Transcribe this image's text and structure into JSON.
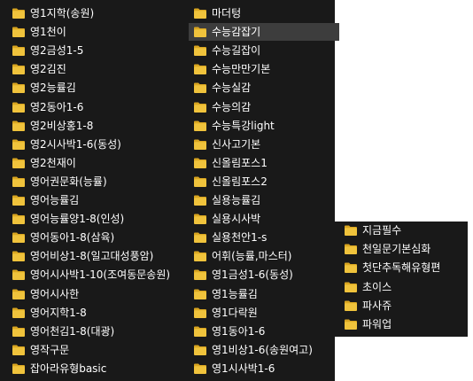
{
  "colors": {
    "background": "#191919",
    "selected": "#3d3d3d",
    "text": "#ffffff",
    "folder": "#f0c33c",
    "folder_dark": "#d9a520"
  },
  "left_column": [
    {
      "label": "영1지학(송원)",
      "icon": "folder-icon"
    },
    {
      "label": "영1천이",
      "icon": "folder-icon"
    },
    {
      "label": "영2금성1-5",
      "icon": "folder-icon"
    },
    {
      "label": "영2김진",
      "icon": "folder-icon"
    },
    {
      "label": "영2능률김",
      "icon": "folder-icon"
    },
    {
      "label": "영2동아1-6",
      "icon": "folder-icon"
    },
    {
      "label": "영2비상홍1-8",
      "icon": "folder-icon"
    },
    {
      "label": "영2시사박1-6(동성)",
      "icon": "folder-icon"
    },
    {
      "label": "영2천재이",
      "icon": "folder-icon"
    },
    {
      "label": "영어권문화(능률)",
      "icon": "folder-icon"
    },
    {
      "label": "영어능률김",
      "icon": "folder-icon"
    },
    {
      "label": "영어능률양1-8(인성)",
      "icon": "folder-icon"
    },
    {
      "label": "영어동아1-8(삼육)",
      "icon": "folder-icon"
    },
    {
      "label": "영어비상1-8(일고대성풍암)",
      "icon": "folder-icon"
    },
    {
      "label": "영어시사박1-10(조여동문송원)",
      "icon": "folder-icon"
    },
    {
      "label": "영어시사한",
      "icon": "folder-icon"
    },
    {
      "label": "영어지학1-8",
      "icon": "folder-icon"
    },
    {
      "label": "영어천김1-8(대광)",
      "icon": "folder-icon"
    },
    {
      "label": "영작구문",
      "icon": "folder-icon"
    },
    {
      "label": "잡아라유형basic",
      "icon": "folder-icon"
    }
  ],
  "middle_column": [
    {
      "label": "마더텅",
      "icon": "folder-icon",
      "selected": false
    },
    {
      "label": "수능감잡기",
      "icon": "folder-icon",
      "selected": true
    },
    {
      "label": "수능길잡이",
      "icon": "folder-icon",
      "selected": false
    },
    {
      "label": "수능만만기본",
      "icon": "folder-icon",
      "selected": false
    },
    {
      "label": "수능실감",
      "icon": "folder-icon",
      "selected": false
    },
    {
      "label": "수능의감",
      "icon": "folder-icon",
      "selected": false
    },
    {
      "label": "수능특강light",
      "icon": "folder-icon",
      "selected": false
    },
    {
      "label": "신사고기본",
      "icon": "folder-icon",
      "selected": false
    },
    {
      "label": "신올림포스1",
      "icon": "folder-icon",
      "selected": false
    },
    {
      "label": "신올림포스2",
      "icon": "folder-icon",
      "selected": false
    },
    {
      "label": "실용능률김",
      "icon": "folder-icon",
      "selected": false
    },
    {
      "label": "실용시사박",
      "icon": "folder-icon",
      "selected": false
    },
    {
      "label": "실용천안1-s",
      "icon": "folder-icon",
      "selected": false
    },
    {
      "label": "어휘(능률,마스터)",
      "icon": "folder-icon",
      "selected": false
    },
    {
      "label": "영1금성1-6(동성)",
      "icon": "folder-icon",
      "selected": false
    },
    {
      "label": "영1능률김",
      "icon": "folder-icon",
      "selected": false
    },
    {
      "label": "영1다락원",
      "icon": "folder-icon",
      "selected": false
    },
    {
      "label": "영1동아1-6",
      "icon": "folder-icon",
      "selected": false
    },
    {
      "label": "영1비상1-6(송원여고)",
      "icon": "folder-icon",
      "selected": false
    },
    {
      "label": "영1시사박1-6",
      "icon": "folder-icon",
      "selected": false
    }
  ],
  "right_column": [
    {
      "label": "지금필수",
      "icon": "folder-icon"
    },
    {
      "label": "천일문기본심화",
      "icon": "folder-icon"
    },
    {
      "label": "첫단추독해유형편",
      "icon": "folder-icon"
    },
    {
      "label": "초이스",
      "icon": "folder-icon"
    },
    {
      "label": "파사쥬",
      "icon": "folder-icon"
    },
    {
      "label": "파워업",
      "icon": "folder-icon"
    }
  ]
}
